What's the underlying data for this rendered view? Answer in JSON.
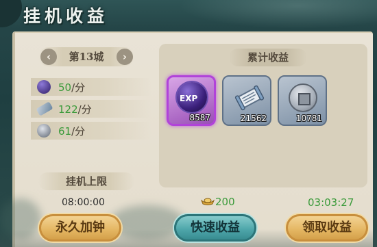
{
  "header": {
    "title": "挂机收益"
  },
  "city": {
    "label": "第13城",
    "prev_icon": "chevron-left",
    "next_icon": "chevron-right"
  },
  "rates": [
    {
      "icon": "exp-orb-icon",
      "value": "50",
      "unit": "/分"
    },
    {
      "icon": "scroll-icon",
      "value": "122",
      "unit": "/分"
    },
    {
      "icon": "coin-icon",
      "value": "61",
      "unit": "/分"
    }
  ],
  "idle_limit": {
    "label": "挂机上限",
    "time": "08:00:00"
  },
  "rewards": {
    "title": "累计收益",
    "items": [
      {
        "name": "EXP",
        "count": "8587"
      },
      {
        "name": "scroll",
        "count": "21562"
      },
      {
        "name": "coin",
        "count": "10781"
      }
    ]
  },
  "cost": {
    "value": "200"
  },
  "timer": {
    "value": "03:03:27"
  },
  "buttons": {
    "extend": "永久加钟",
    "quick": "快速收益",
    "claim": "领取收益"
  },
  "colors": {
    "green": "#3a9a3a",
    "gold_button": "#e5b865",
    "teal_button": "#4fa7ab",
    "exp_border": "#b143d9"
  }
}
